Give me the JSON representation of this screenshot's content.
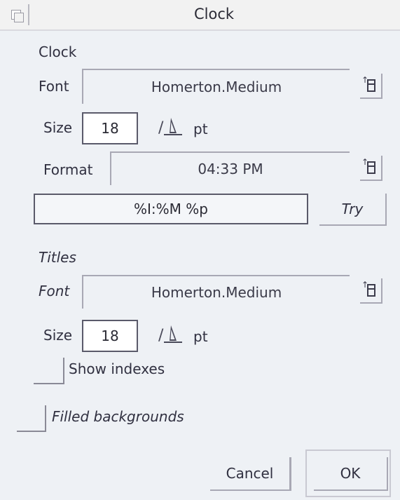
{
  "window": {
    "title": "Clock"
  },
  "clock_section": {
    "heading": "Clock",
    "font_label": "Font",
    "font_value": "Homerton.Medium",
    "size_label": "Size",
    "size_value": "18",
    "size_unit": "pt",
    "format_label": "Format",
    "format_value": "04:33 PM",
    "format_string": "%I:%M %p",
    "try_label": "Try"
  },
  "titles_section": {
    "heading": "Titles",
    "font_label": "Font",
    "font_value": "Homerton.Medium",
    "size_label": "Size",
    "size_value": "18",
    "size_unit": "pt"
  },
  "options": {
    "show_indexes_label": "Show indexes",
    "show_indexes_checked": false,
    "filled_backgrounds_label": "Filled backgrounds",
    "filled_backgrounds_checked": false
  },
  "buttons": {
    "cancel_label": "Cancel",
    "ok_label": "OK"
  },
  "icons": {
    "back": "window-back-icon",
    "menu": "popup-menu-icon",
    "adjust": "size-adjust-icon"
  }
}
